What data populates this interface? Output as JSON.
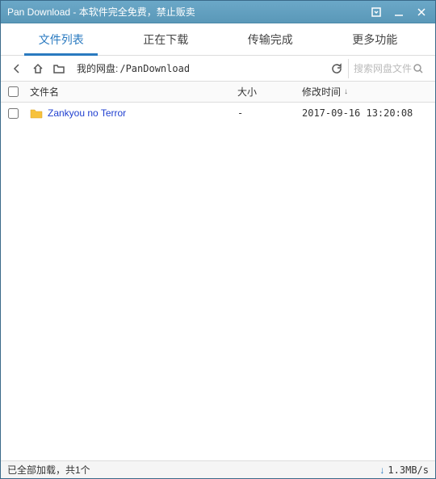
{
  "titlebar": {
    "text": "Pan Download - 本软件完全免费，禁止贩卖"
  },
  "tabs": {
    "items": [
      {
        "label": "文件列表",
        "active": true
      },
      {
        "label": "正在下载",
        "active": false
      },
      {
        "label": "传输完成",
        "active": false
      },
      {
        "label": "更多功能",
        "active": false
      }
    ]
  },
  "toolbar": {
    "path_label": "我的网盘:",
    "path_value": "/PanDownload",
    "search_placeholder": "搜索网盘文件"
  },
  "columns": {
    "name": "文件名",
    "size": "大小",
    "date": "修改时间"
  },
  "rows": [
    {
      "name": "Zankyou no Terror",
      "size": "-",
      "date": "2017-09-16 13:20:08"
    }
  ],
  "status": {
    "text": "已全部加载，共1个",
    "speed": "1.3MB/s"
  }
}
